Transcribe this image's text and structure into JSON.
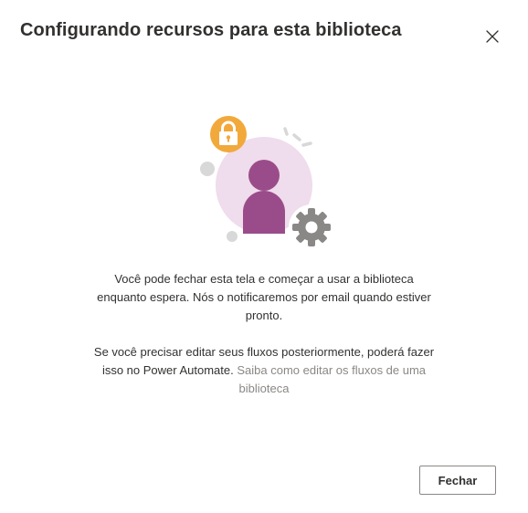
{
  "dialog": {
    "title": "Configurando recursos para esta biblioteca",
    "close_icon": "close-icon"
  },
  "illustration": {
    "icons": [
      "lock-icon",
      "user-icon",
      "gear-icon"
    ],
    "colors": {
      "circle": "#efdcec",
      "user": "#9a4c8a",
      "lock_badge": "#f2a93b",
      "gear": "#8a8886",
      "dots": "#d8d8d8"
    }
  },
  "body": {
    "paragraph1": "Você pode fechar esta tela e começar a usar a biblioteca enquanto espera. Nós o notificaremos por email quando estiver pronto.",
    "paragraph2_text": "Se você precisar editar seus fluxos posteriormente, poderá fazer isso no Power Automate.",
    "paragraph2_link": "Saiba como editar os fluxos de uma biblioteca"
  },
  "footer": {
    "close_label": "Fechar"
  }
}
